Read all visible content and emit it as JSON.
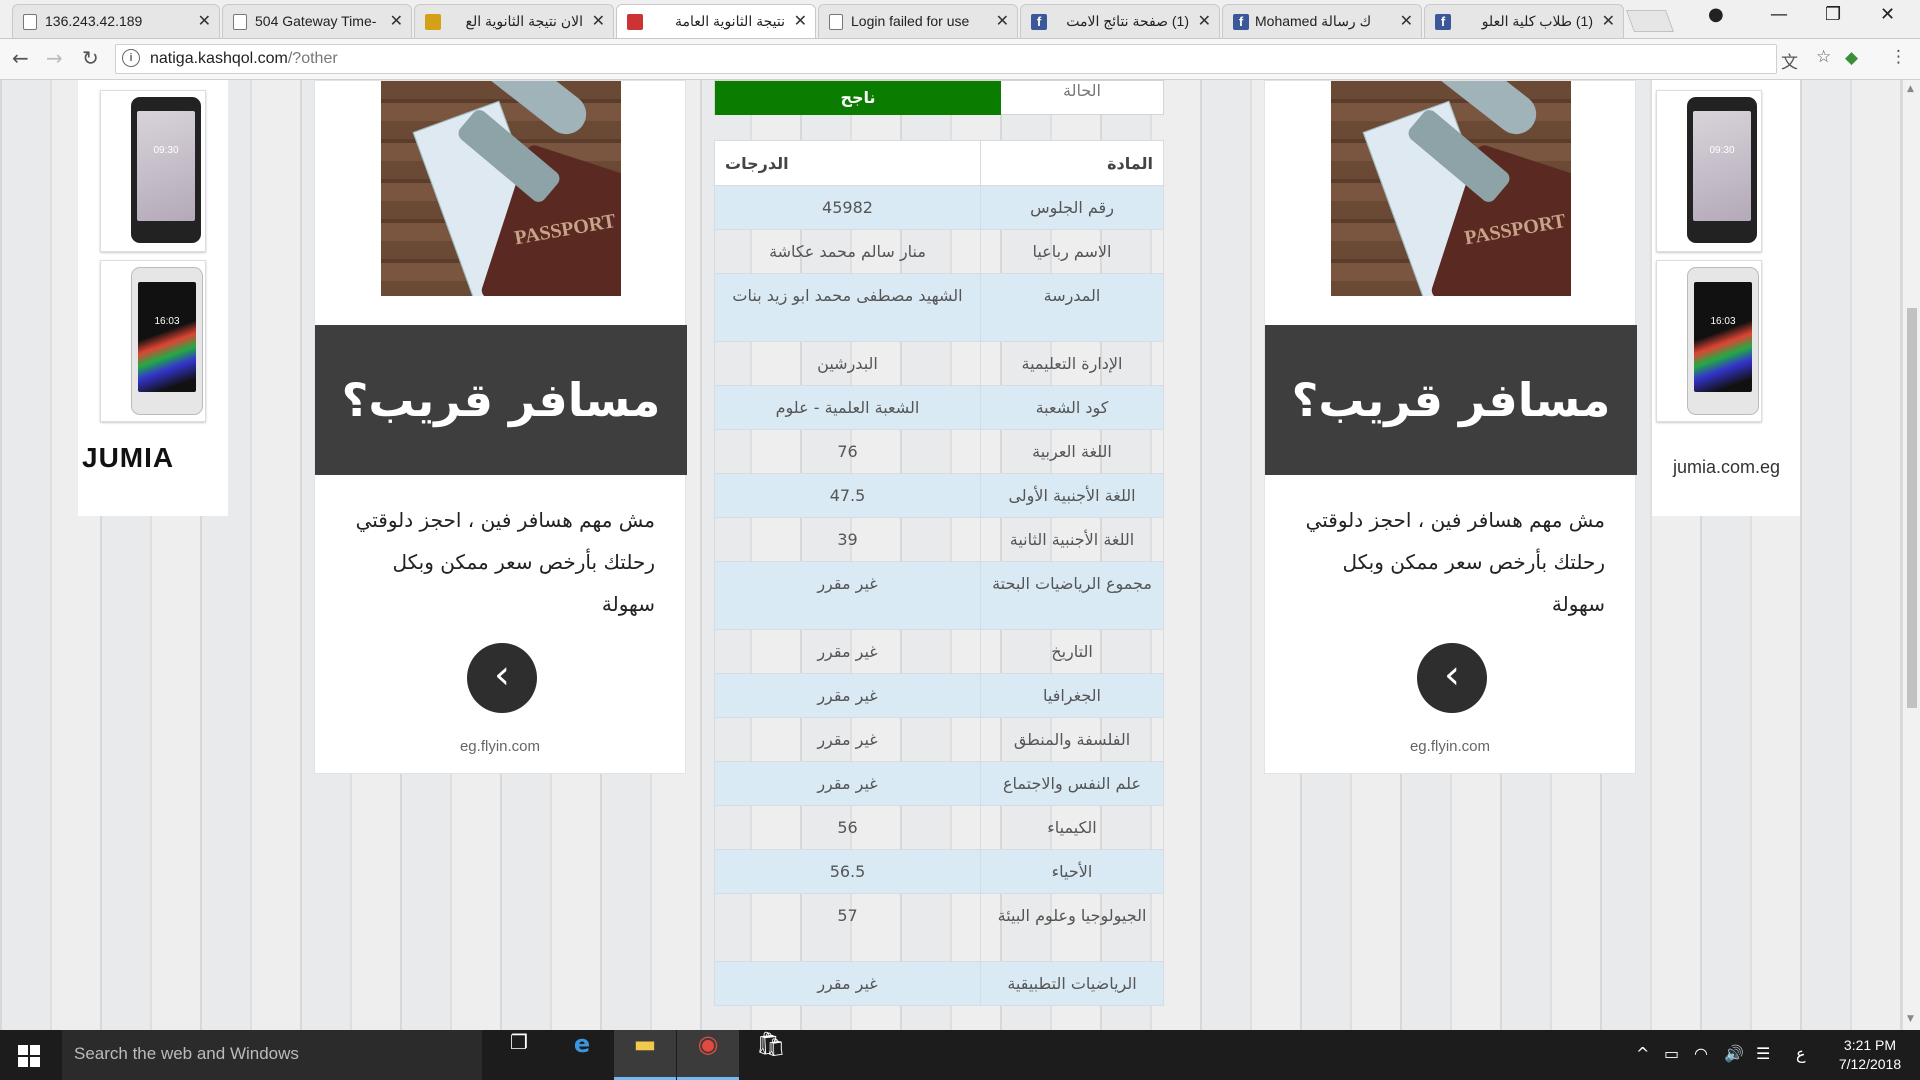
{
  "browser": {
    "tabs": [
      {
        "title": "136.243.42.189",
        "icon": "page-icon"
      },
      {
        "title": "504 Gateway Time-",
        "icon": "page-icon"
      },
      {
        "title": "الان نتيجة الثانوية الع",
        "icon": "site-logo-icon"
      },
      {
        "title": "نتيجة الثانوية العامة",
        "icon": "site-logo-icon",
        "active": true
      },
      {
        "title": "Login failed for use",
        "icon": "page-icon"
      },
      {
        "title": "(1) صفحة نتائج الامت",
        "icon": "facebook-icon"
      },
      {
        "title": "Mohamed ك رسالة",
        "icon": "facebook-icon"
      },
      {
        "title": "(1) طلاب كلية العلو",
        "icon": "facebook-icon"
      }
    ],
    "url_host": "natiga.kashqol.com",
    "url_path": "/?other"
  },
  "left_ad": {
    "headline": "مسافر قريب؟",
    "body": "مش مهم هسافر فين ، احجز دلوقتي رحلتك بأرخص سعر ممكن وبكل سهولة",
    "domain": "eg.flyin.com",
    "passport_text": "PASSPORT"
  },
  "right_ad": {
    "headline": "مسافر قريب؟",
    "body": "مش مهم هسافر فين ، احجز دلوقتي رحلتك بأرخص سعر ممكن وبكل سهولة",
    "domain": "eg.flyin.com",
    "passport_text": "PASSPORT"
  },
  "side_ads": {
    "phone_clock_1": "09:30",
    "phone_clock_2": "16:03",
    "jumia_logo": "JUMIA",
    "jumia_url": "jumia.com.eg"
  },
  "result": {
    "status_label": "الحالة",
    "status_value": "ناجح",
    "header_subject": "المادة",
    "header_grade": "الدرجات",
    "rows": [
      {
        "subject": "رقم الجلوس",
        "value": "45982"
      },
      {
        "subject": "الاسم رباعيا",
        "value": "منار سالم محمد عكاشة"
      },
      {
        "subject": "المدرسة",
        "value": "الشهيد مصطفى محمد ابو زيد بنات"
      },
      {
        "subject": "الإدارة التعليمية",
        "value": "البدرشين"
      },
      {
        "subject": "كود الشعبة",
        "value": "الشعبة العلمية - علوم"
      },
      {
        "subject": "اللغة العربية",
        "value": "76"
      },
      {
        "subject": "اللغة الأجنبية الأولى",
        "value": "47.5"
      },
      {
        "subject": "اللغة الأجنبية الثانية",
        "value": "39"
      },
      {
        "subject": "مجموع الرياضيات البحتة",
        "value": "غير مقرر"
      },
      {
        "subject": "التاريخ",
        "value": "غير مقرر"
      },
      {
        "subject": "الجغرافيا",
        "value": "غير مقرر"
      },
      {
        "subject": "الفلسفة والمنطق",
        "value": "غير مقرر"
      },
      {
        "subject": "علم النفس والاجتماع",
        "value": "غير مقرر"
      },
      {
        "subject": "الكيمياء",
        "value": "56"
      },
      {
        "subject": "الأحياء",
        "value": "56.5"
      },
      {
        "subject": "الجيولوجيا وعلوم البيئة",
        "value": "57"
      },
      {
        "subject": "الرياضيات التطبيقية",
        "value": "غير مقرر"
      }
    ]
  },
  "taskbar": {
    "search_placeholder": "Search the web and Windows",
    "time": "3:21 PM",
    "date": "7/12/2018",
    "lang": "ع",
    "apps": [
      "task-view-icon",
      "edge-icon",
      "file-explorer-icon",
      "chrome-icon",
      "store-icon"
    ]
  },
  "colors": {
    "status_green": "#0a7d00",
    "row_alt": "#daeaf4",
    "ad_banner": "#3e3e3e"
  }
}
